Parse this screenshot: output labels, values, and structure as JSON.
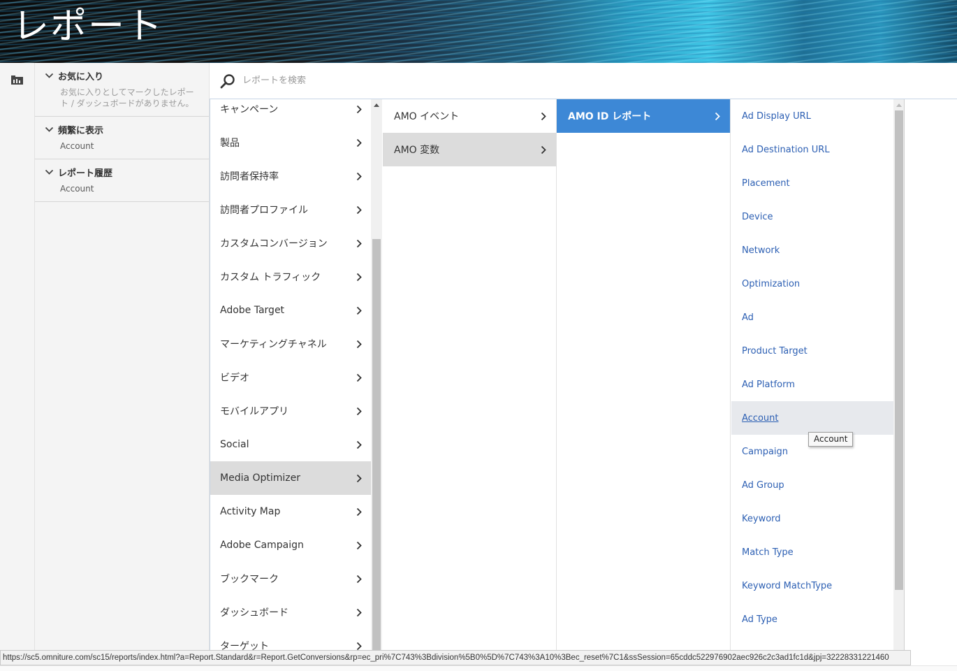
{
  "header": {
    "title": "レポート"
  },
  "rail": {
    "icon": "folder-icon"
  },
  "sidebar": {
    "favorites": {
      "title": "お気に入り",
      "empty_text": "お気に入りとしてマークしたレポート / ダッシュボードがありません。"
    },
    "frequent": {
      "title": "頻繁に表示",
      "items": [
        "Account"
      ]
    },
    "history": {
      "title": "レポート履歴",
      "items": [
        "Account"
      ]
    }
  },
  "search": {
    "placeholder": "レポートを検索",
    "value": ""
  },
  "columns": {
    "col1": {
      "items": [
        "キャンペーン",
        "製品",
        "訪問者保持率",
        "訪問者プロファイル",
        "カスタムコンバージョン",
        "カスタム トラフィック",
        "Adobe Target",
        "マーケティングチャネル",
        "ビデオ",
        "モバイルアプリ",
        "Social",
        "Media Optimizer",
        "Activity Map",
        "Adobe Campaign",
        "ブックマーク",
        "ダッシュボード",
        "ターゲット"
      ],
      "active": "Media Optimizer"
    },
    "col2": {
      "items": [
        "AMO イベント",
        "AMO 変数"
      ],
      "active": "AMO 変数"
    },
    "col3": {
      "items": [
        "AMO ID レポート"
      ],
      "selected": "AMO ID レポート"
    },
    "col4": {
      "items": [
        "Ad Display URL",
        "Ad Destination URL",
        "Placement",
        "Device",
        "Network",
        "Optimization",
        "Ad",
        "Product Target",
        "Ad Platform",
        "Account",
        "Campaign",
        "Ad Group",
        "Keyword",
        "Match Type",
        "Keyword MatchType",
        "Ad Type"
      ],
      "hovered": "Account"
    }
  },
  "tooltip": {
    "text": "Account"
  },
  "statusbar": {
    "url": "https://sc5.omniture.com/sc15/reports/index.html?a=Report.Standard&r=Report.GetConversions&rp=ec_pri%7C743%3Bdivision%5B0%5D%7C743%3A10%3Bec_reset%7C1&ssSession=65cddc522976902aec926c2c3ad1fc1d&jpj=32228331221460"
  },
  "colors": {
    "selected": "#3d88d6",
    "link": "#2c5fb3",
    "active_row": "#dcdcdc"
  }
}
